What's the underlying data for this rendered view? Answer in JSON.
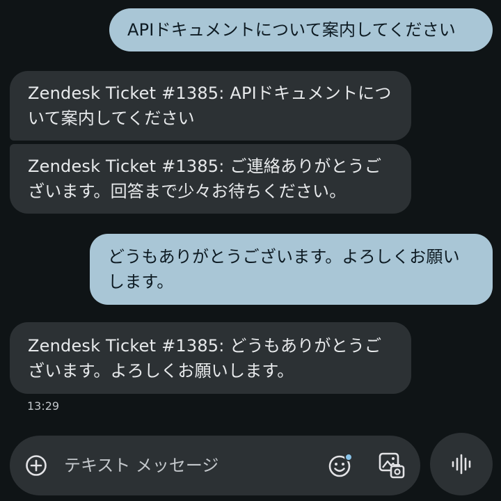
{
  "messages": [
    {
      "direction": "outgoing",
      "text": "APIドキュメントについて案内してください"
    },
    {
      "direction": "incoming",
      "text": "Zendesk Ticket #1385: APIドキュメントについて案内してください"
    },
    {
      "direction": "incoming",
      "text": "Zendesk Ticket #1385: ご連絡ありがとうございます。回答まで少々お待ちください。"
    },
    {
      "direction": "outgoing",
      "text": "どうもありがとうございます。よろしくお願いします。"
    },
    {
      "direction": "incoming",
      "text": "Zendesk Ticket #1385: どうもありがとうございます。よろしくお願いします。"
    }
  ],
  "timestamp": "13:29",
  "compose": {
    "placeholder": "テキスト メッセージ"
  },
  "icons": {
    "add": "add-circle-icon",
    "emoji": "emoji-icon",
    "gallery": "gallery-icon",
    "voice": "voice-waveform-icon"
  },
  "colors": {
    "background": "#0f1416",
    "outgoing_bubble": "#a9c6d6",
    "incoming_bubble": "#2c3134",
    "emoji_dot": "#8ac4ea"
  }
}
